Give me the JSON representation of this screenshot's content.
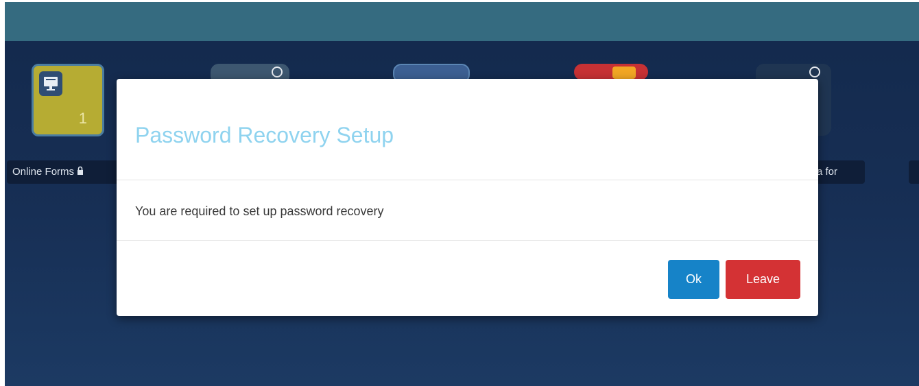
{
  "desktop": {
    "tiles": [
      {
        "label": "Online Forms",
        "badge_count": "1"
      },
      {
        "label": "a for"
      }
    ]
  },
  "modal": {
    "title": "Password Recovery Setup",
    "message": "You are required to set up password recovery",
    "ok_label": "Ok",
    "leave_label": "Leave"
  },
  "colors": {
    "top_bar": "#356b80",
    "background": "#13294c",
    "title": "#8fd3ef",
    "ok_button": "#1683c8",
    "leave_button": "#d43234"
  }
}
